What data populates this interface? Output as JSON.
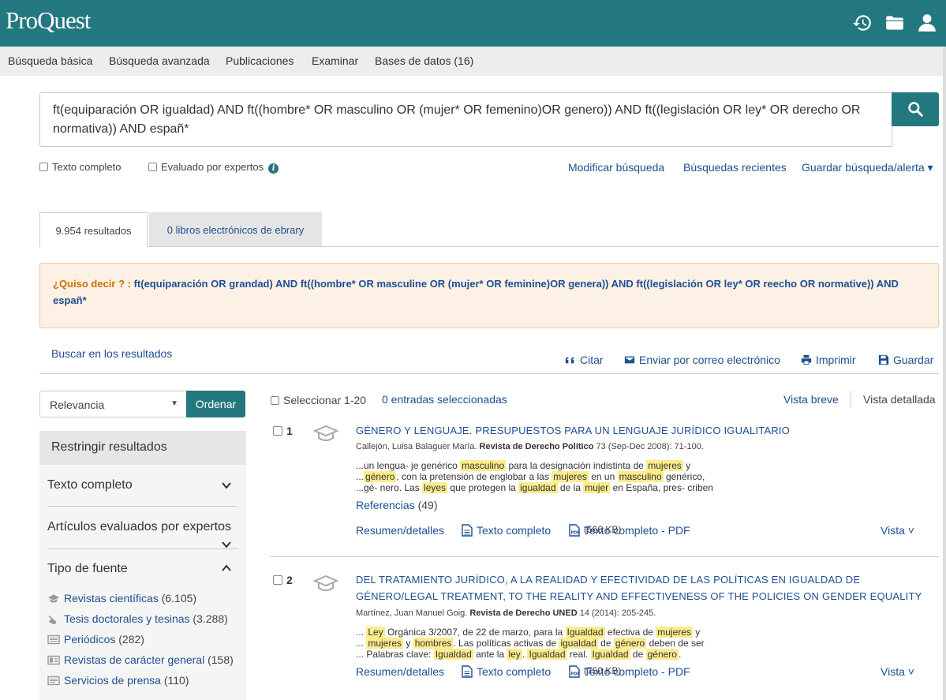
{
  "app": {
    "logo": "ProQuest"
  },
  "topbar": {
    "icons": [
      "history-icon",
      "folder-icon",
      "user-icon"
    ]
  },
  "nav": {
    "items": [
      "Búsqueda básica",
      "Búsqueda avanzada",
      "Publicaciones",
      "Examinar",
      "Bases de datos (16)"
    ]
  },
  "search": {
    "query": "ft(equiparación OR igualdad) AND ft((hombre* OR masculino OR (mujer* OR femenino)OR genero)) AND ft((legislación OR ley* OR derecho OR normativa)) AND españ*"
  },
  "filters": {
    "full_text": "Texto completo",
    "peer_reviewed": "Evaluado por expertos"
  },
  "links": {
    "modify": "Modificar búsqueda",
    "recent": "Búsquedas recientes",
    "save_alert": "Guardar búsqueda/alerta ▾"
  },
  "tabs": {
    "results": "9.954 resultados",
    "ebooks": "0 libros electrónicos de ebrary"
  },
  "didyoumean": {
    "label": "¿Quiso decir ? :",
    "suggestion": "ft(equiparación OR grandad) AND ft((hombre* OR masculine OR (mujer* OR feminine)OR genera)) AND ft((legislación OR ley* OR reecho OR normative)) AND españ*"
  },
  "toolbar": {
    "search_within": "Buscar en los resultados",
    "cite": "Citar",
    "email": "Enviar por correo electrónico",
    "print": "Imprimir",
    "save": "Guardar"
  },
  "sort": {
    "selected": "Relevancia",
    "button": "Ordenar"
  },
  "sidebar": {
    "header": "Restringir resultados",
    "sections": [
      "Texto completo",
      "Artículos evaluados por expertos",
      "Tipo de fuente"
    ],
    "source_types": [
      {
        "label": "Revistas científicas",
        "count": "(6.105)",
        "icon": "scholarly-icon"
      },
      {
        "label": "Tesis doctorales y tesinas",
        "count": "(3.288)",
        "icon": "thesis-icon"
      },
      {
        "label": "Periódicos",
        "count": "(282)",
        "icon": "newspaper-icon"
      },
      {
        "label": "Revistas de carácter general",
        "count": "(158)",
        "icon": "magazine-icon"
      },
      {
        "label": "Servicios de prensa",
        "count": "(110)",
        "icon": "wire-icon"
      }
    ]
  },
  "results_bar": {
    "select_all": "Seleccionar 1-20",
    "selected": "0 entradas seleccionadas",
    "view_brief": "Vista breve",
    "view_detailed": "Vista detallada"
  },
  "results": [
    {
      "num": "1",
      "title": "GÉNERO Y LENGUAJE. PRESUPUESTOS PARA UN LENGUAJE JURÍDICO IGUALITARIO",
      "authors": "Callejón, Luisa Balaguer María.",
      "journal": "Revista de Derecho Político",
      "details": "73  (Sep-Dec 2008): 71-100.",
      "refs_label": "Referencias",
      "refs_count": "(49)",
      "links": {
        "summary": "Resumen/detalles",
        "fulltext": "Texto completo",
        "pdf": "Texto completo - PDF",
        "pdf_size": "(566 KB)",
        "view": "Vista ˅"
      }
    },
    {
      "num": "2",
      "title": "DEL TRATAMIENTO JURÍDICO, A LA REALIDAD Y EFECTIVIDAD DE LAS POLÍTICAS EN IGUALDAD DE GÉNERO/LEGAL TREATMENT, TO THE REALITY AND EFFECTIVENESS OF THE POLICIES ON GENDER EQUALITY",
      "authors": "Martínez, Juan Manuel Goig.",
      "journal": "Revista de Derecho UNED",
      "details": "14  (2014): 205-245.",
      "links": {
        "summary": "Resumen/detalles",
        "fulltext": "Texto completo",
        "pdf": "Texto completo - PDF",
        "pdf_size": "(750 KB)",
        "view": "Vista ˅"
      }
    }
  ],
  "snippet1": {
    "l1a": "...un lengua- je genérico ",
    "l1h1": "masculino",
    "l1b": " para la designación indistinta de ",
    "l1h2": "mujeres",
    "l1c": " y",
    "l2a": "...",
    "l2h1": "género",
    "l2b": ", con la pretensión de englobar a las ",
    "l2h2": "mujeres",
    "l2c": " en un ",
    "l2h3": "masculino",
    "l2d": " genérico,",
    "l3a": "...gé- nero. Las ",
    "l3h1": "leyes",
    "l3b": " que protegen la ",
    "l3h2": "igualdad",
    "l3c": " de la ",
    "l3h3": "mujer",
    "l3d": " en España, pres- criben"
  },
  "snippet2": {
    "l1a": "... ",
    "l1h1": "Ley",
    "l1b": " Orgánica 3/2007, de 22 de marzo, para la ",
    "l1h2": "Igualdad",
    "l1c": " efectiva de ",
    "l1h3": "mujeres",
    "l1d": " y",
    "l2a": "... ",
    "l2h1": "mujeres",
    "l2b": " y ",
    "l2h2": "hombres",
    "l2c": ". Las políticas activas de ",
    "l2h3": "igualdad",
    "l2d": " de ",
    "l2h4": "género",
    "l2e": " deben de ser",
    "l3a": "... Palabras clave: ",
    "l3h1": "Igualdad",
    "l3b": " ante la ",
    "l3h2": "ley",
    "l3c": ". ",
    "l3h3": "Igualdad",
    "l3d": " real. ",
    "l3h4": "Igualdad",
    "l3e": " de ",
    "l3h5": "género",
    "l3f": "."
  },
  "colors": {
    "brand": "#23787f",
    "link": "#1d4f91",
    "highlight": "#fcec8c",
    "suggestion_bg": "#fdf1e6"
  }
}
